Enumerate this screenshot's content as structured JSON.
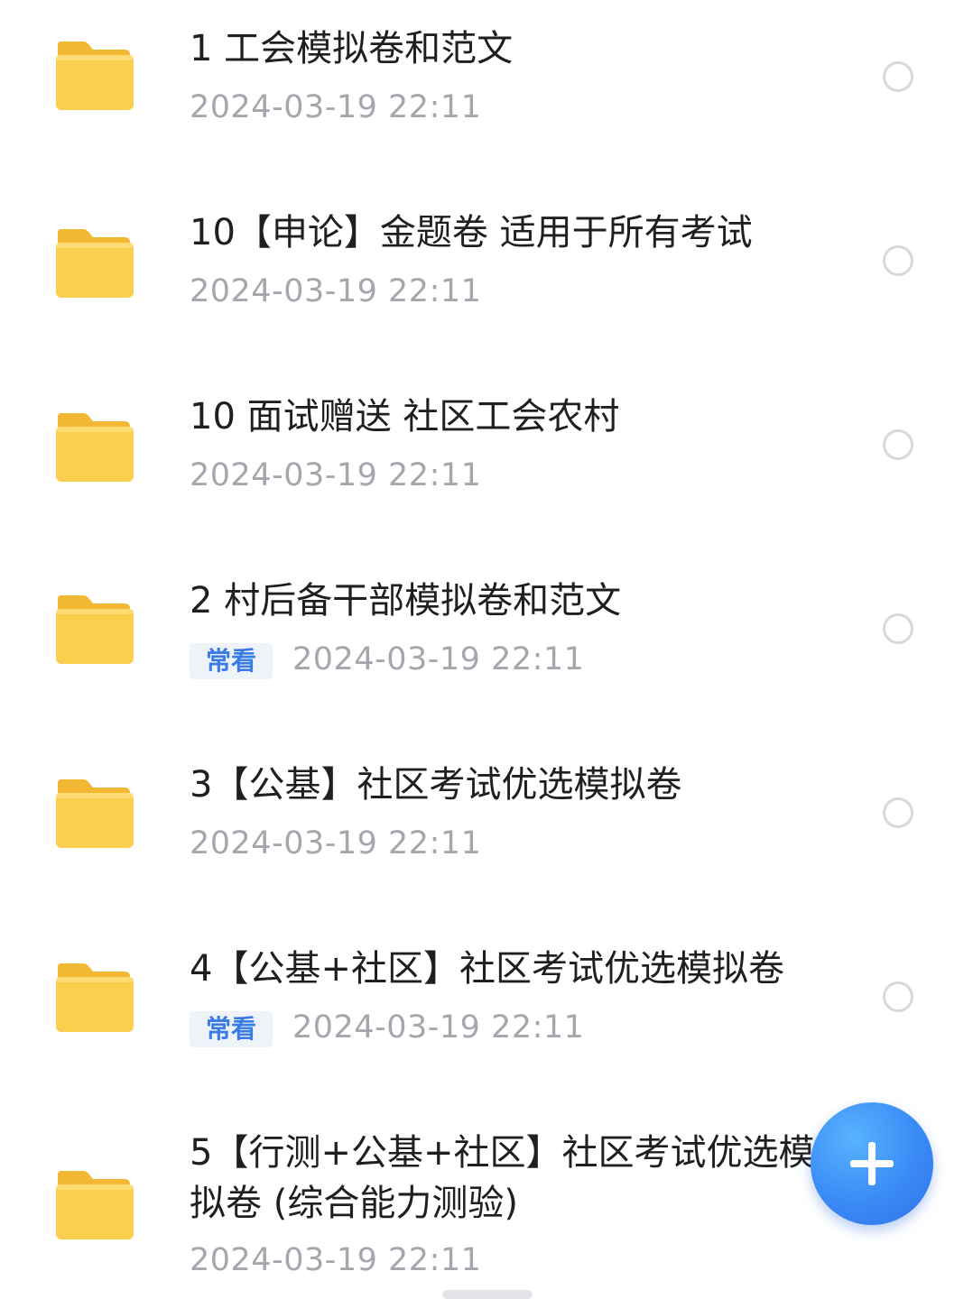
{
  "files": [
    {
      "title": "1 工会模拟卷和范文",
      "date": "2024-03-19  22:11",
      "badge": ""
    },
    {
      "title": "10【申论】金题卷 适用于所有考试",
      "date": "2024-03-19  22:11",
      "badge": ""
    },
    {
      "title": "10 面试赠送 社区工会农村",
      "date": "2024-03-19  22:11",
      "badge": ""
    },
    {
      "title": "2 村后备干部模拟卷和范文",
      "date": "2024-03-19  22:11",
      "badge": "常看"
    },
    {
      "title": "3【公基】社区考试优选模拟卷",
      "date": "2024-03-19  22:11",
      "badge": ""
    },
    {
      "title": "4【公基+社区】社区考试优选模拟卷",
      "date": "2024-03-19  22:11",
      "badge": "常看"
    },
    {
      "title": "5【行测+公基+社区】社区考试优选模拟卷 (综合能力测验)",
      "date": "2024-03-19  22:11",
      "badge": ""
    }
  ],
  "icons": {
    "folder": "folder-icon",
    "select": "radio-circle-icon",
    "add": "plus-icon"
  },
  "colors": {
    "folder": "#f9cf4d",
    "badge_text": "#3a7be8",
    "fab": "#3a8af5",
    "date": "#a4a7ad"
  }
}
